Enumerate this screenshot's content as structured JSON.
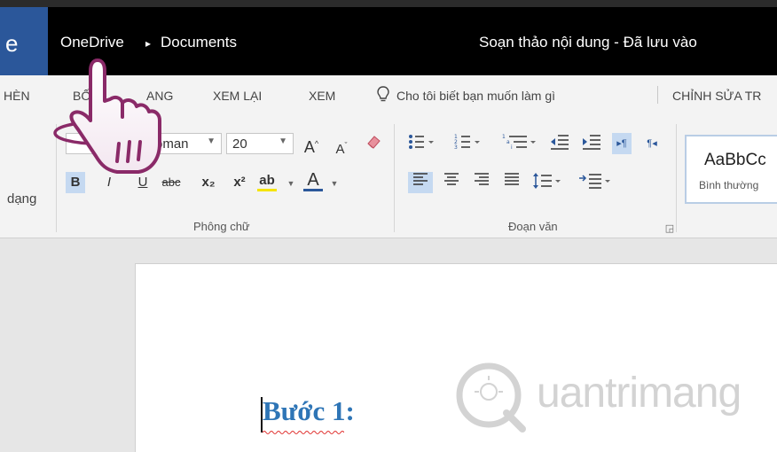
{
  "titlebar": {
    "app_letter": "e",
    "breadcrumb_root": "OneDrive",
    "breadcrumb_separator": "▸",
    "breadcrumb_folder": "Documents",
    "doc_title": "Soạn thảo nội dung   -   Đã lưu vào"
  },
  "tabs": {
    "items": [
      "HÈN",
      "BỐ",
      "ANG",
      "XEM LẠI",
      "XEM"
    ],
    "tell_me": "Cho tôi biết bạn muốn làm gì",
    "edit_in": "CHỈNH SỬA TR"
  },
  "ribbon": {
    "left_label": "dạng",
    "font_name": "oman",
    "font_size": "20",
    "font_group_label": "Phông chữ",
    "paragraph_group_label": "Đoạn văn",
    "bold": "B",
    "italic": "I",
    "strikethrough": "abc",
    "subscript": "x₂",
    "superscript": "x²",
    "highlight": "ab",
    "font_color": "A",
    "grow_font": "A",
    "shrink_font": "A",
    "style_sample": "AaBbCc",
    "style_name": "Bình thường"
  },
  "document": {
    "heading": "Bước 1:",
    "watermark": "uantrimang"
  },
  "colors": {
    "titlebar_bg": "#000000",
    "app_tile": "#2b579a",
    "ribbon_bg": "#f3f3f3",
    "heading_color": "#2e75b6",
    "selected_button": "#c5d9f1"
  },
  "icons": {
    "cursor": "hand-pointer-icon",
    "tell_me": "lightbulb-icon",
    "clear_format": "eraser-icon",
    "dialog_launcher": "dialog-launcher-icon"
  }
}
